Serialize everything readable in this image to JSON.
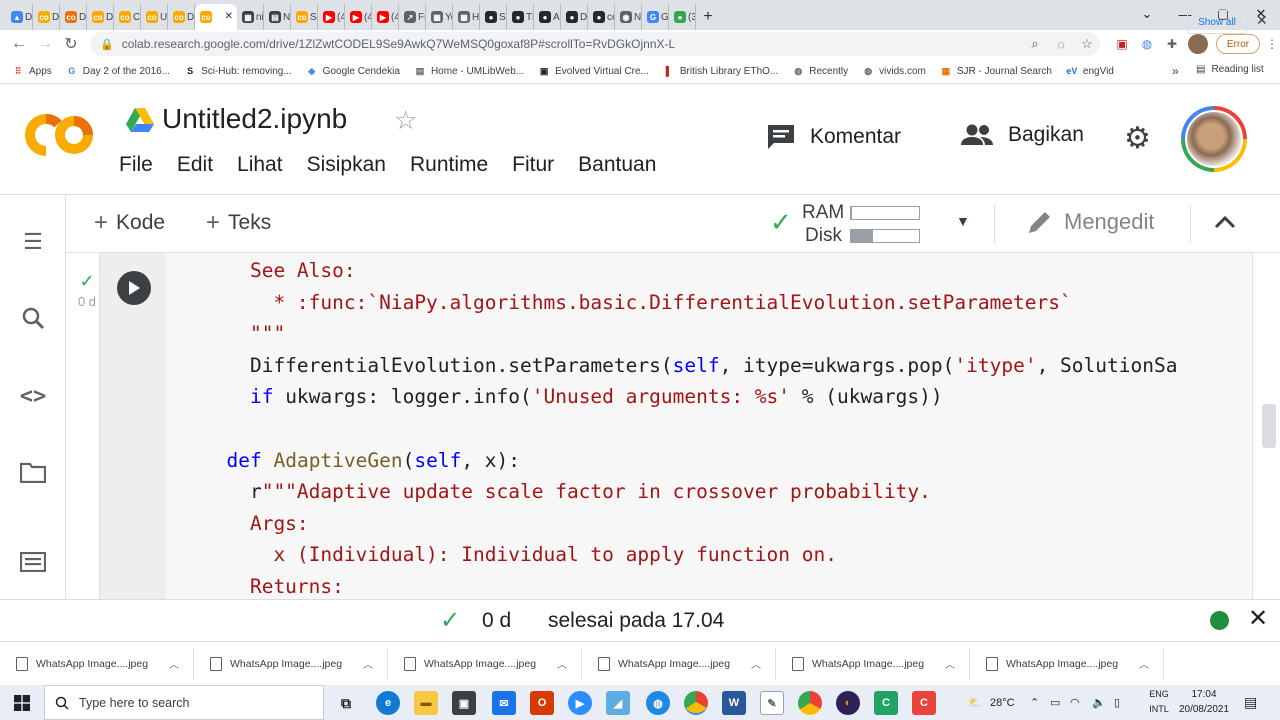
{
  "browser": {
    "tabs": [
      {
        "label": "Dr",
        "color": "#4285f4",
        "glyph": "▲"
      },
      {
        "label": "DE",
        "color": "#f9ab00",
        "glyph": "co"
      },
      {
        "label": "DE",
        "color": "#e8710a",
        "glyph": "co"
      },
      {
        "label": "DE",
        "color": "#f9ab00",
        "glyph": "co"
      },
      {
        "label": "Ch",
        "color": "#f9ab00",
        "glyph": "co"
      },
      {
        "label": "Ur",
        "color": "#f9ab00",
        "glyph": "co"
      },
      {
        "label": "DE",
        "color": "#f9ab00",
        "glyph": "co"
      },
      {
        "label": "",
        "color": "#f9ab00",
        "glyph": "co"
      },
      {
        "label": "ni",
        "color": "#3c4043",
        "glyph": "▦"
      },
      {
        "label": "Ni",
        "color": "#3c4043",
        "glyph": "▤"
      },
      {
        "label": "SA",
        "color": "#f9ab00",
        "glyph": "co"
      },
      {
        "label": "(4",
        "color": "#ff0000",
        "glyph": "▶"
      },
      {
        "label": "(4",
        "color": "#ff0000",
        "glyph": "▶"
      },
      {
        "label": "(4",
        "color": "#ff0000",
        "glyph": "▶"
      },
      {
        "label": "Fr",
        "color": "#5f6368",
        "glyph": "↗"
      },
      {
        "label": "Yo",
        "color": "#5f6368",
        "glyph": "▦"
      },
      {
        "label": "Hc",
        "color": "#5f6368",
        "glyph": "▦"
      },
      {
        "label": "Se",
        "color": "#24292e",
        "glyph": "●"
      },
      {
        "label": "Th",
        "color": "#24292e",
        "glyph": "●"
      },
      {
        "label": "Al",
        "color": "#24292e",
        "glyph": "●"
      },
      {
        "label": "Di",
        "color": "#24292e",
        "glyph": "●"
      },
      {
        "label": "ce",
        "color": "#24292e",
        "glyph": "●"
      },
      {
        "label": "Ne",
        "color": "#5f6368",
        "glyph": "◉"
      },
      {
        "label": "Gc",
        "color": "#4285f4",
        "glyph": "G"
      },
      {
        "label": "(3",
        "color": "#34a853",
        "glyph": "●"
      }
    ],
    "url": "colab.research.google.com/drive/1ZlZwtCODEL9Se9AwkQ7WeMSQ0goxaf8P#scrollTo=RvDGkOjnnX-L",
    "error_label": "Error",
    "bookmarks": [
      {
        "label": "Apps",
        "icon": "apps-grid-icon"
      },
      {
        "label": "Day 2 of the 2016...",
        "icon": "google-icon"
      },
      {
        "label": "Sci-Hub: removing...",
        "icon": "scihub-icon"
      },
      {
        "label": "Google Cendekia",
        "icon": "scholar-icon"
      },
      {
        "label": "Home - UMLibWeb...",
        "icon": "umlib-icon"
      },
      {
        "label": "Evolved Virtual Cre...",
        "icon": "page-icon"
      },
      {
        "label": "British Library EThO...",
        "icon": "bl-icon"
      },
      {
        "label": "Recently",
        "icon": "globe-icon"
      },
      {
        "label": "vivids.com",
        "icon": "globe-icon"
      },
      {
        "label": "SJR - Journal Search",
        "icon": "sjr-icon"
      },
      {
        "label": "engVid",
        "icon": "engvid-icon"
      }
    ],
    "reading_list": "Reading list",
    "more_bookmarks": "»"
  },
  "colab": {
    "logo_text": "CO",
    "doc_name": "Untitled2.ipynb",
    "menu": [
      "File",
      "Edit",
      "Lihat",
      "Sisipkan",
      "Runtime",
      "Fitur",
      "Bantuan"
    ],
    "comment_label": "Komentar",
    "share_label": "Bagikan",
    "toolbar": {
      "add_code": "Kode",
      "add_text": "Teks",
      "ram_label": "RAM",
      "disk_label": "Disk",
      "ram_usage": 0.02,
      "disk_usage": 0.33,
      "editing_label": "Mengedit"
    },
    "cell": {
      "exec_time": "0 d",
      "code_lines": [
        [
          {
            "t": "    See Also:",
            "c": "s"
          }
        ],
        [
          {
            "t": "      * :func:`NiaPy.algorithms.basic.DifferentialEvolution.setParameters`",
            "c": "s"
          }
        ],
        [
          {
            "t": "    \"\"\"",
            "c": "s"
          }
        ],
        [
          {
            "t": "    DifferentialEvolution.setParameters(",
            "c": ""
          },
          {
            "t": "self",
            "c": "sf"
          },
          {
            "t": ", itype=ukwargs.pop(",
            "c": ""
          },
          {
            "t": "'itype'",
            "c": "s"
          },
          {
            "t": ", SolutionSa",
            "c": ""
          }
        ],
        [
          {
            "t": "    ",
            "c": ""
          },
          {
            "t": "if",
            "c": "kw"
          },
          {
            "t": " ukwargs: logger.info(",
            "c": ""
          },
          {
            "t": "'Unused arguments: %s'",
            "c": "s"
          },
          {
            "t": " % (ukwargs))",
            "c": ""
          }
        ],
        [
          {
            "t": "",
            "c": ""
          }
        ],
        [
          {
            "t": "  ",
            "c": ""
          },
          {
            "t": "def",
            "c": "kw"
          },
          {
            "t": " ",
            "c": ""
          },
          {
            "t": "AdaptiveGen",
            "c": "fn"
          },
          {
            "t": "(",
            "c": ""
          },
          {
            "t": "self",
            "c": "sf"
          },
          {
            "t": ", x):",
            "c": ""
          }
        ],
        [
          {
            "t": "    r",
            "c": ""
          },
          {
            "t": "\"\"\"Adaptive update scale factor in crossover probability.",
            "c": "s"
          }
        ],
        [
          {
            "t": "    Args:",
            "c": "s"
          }
        ],
        [
          {
            "t": "      x (Individual): Individual to apply function on.",
            "c": "s"
          }
        ],
        [
          {
            "t": "    Returns:",
            "c": "s"
          }
        ]
      ]
    },
    "status": {
      "time": "0 d",
      "text": "selesai pada 17.04"
    }
  },
  "downloads": {
    "items": [
      "WhatsApp Image....jpeg",
      "WhatsApp Image....jpeg",
      "WhatsApp Image....jpeg",
      "WhatsApp Image....jpeg",
      "WhatsApp Image....jpeg",
      "WhatsApp Image....jpeg"
    ],
    "show_all": "Show all"
  },
  "taskbar": {
    "search_placeholder": "Type here to search",
    "temperature": "28°C",
    "lang_top": "ENG",
    "lang_bottom": "INTL",
    "time": "17:04",
    "date": "20/08/2021"
  }
}
